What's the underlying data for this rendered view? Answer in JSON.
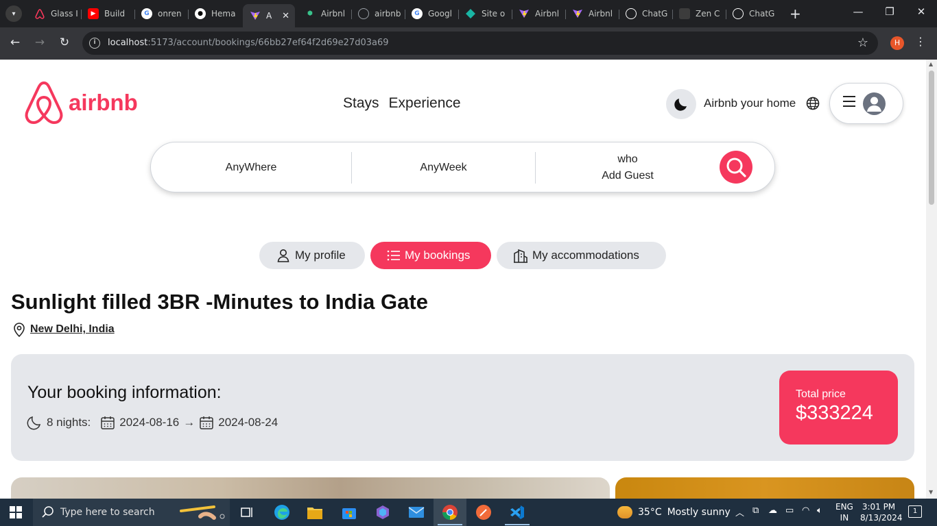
{
  "browser": {
    "tabs": [
      {
        "label": "Glass I",
        "icon": "airbnb-icon",
        "color": "#ff385c"
      },
      {
        "label": "Build",
        "icon": "youtube-icon",
        "color": "#ff0000"
      },
      {
        "label": "onren",
        "icon": "google-icon",
        "color": "#ffffff"
      },
      {
        "label": "Hema",
        "icon": "github-icon",
        "color": "#ffffff"
      },
      {
        "label": "A",
        "icon": "vite-icon",
        "color": "#a86bff",
        "active": true
      },
      {
        "label": "Airbnl",
        "icon": "shoe-icon",
        "color": "#39c28b"
      },
      {
        "label": "airbnb",
        "icon": "globe-icon",
        "color": "#9aa0a6"
      },
      {
        "label": "Googl",
        "icon": "google-icon",
        "color": "#ffffff"
      },
      {
        "label": "Site o",
        "icon": "netlify-icon",
        "color": "#19b5a4"
      },
      {
        "label": "Airbnl",
        "icon": "vite-icon",
        "color": "#a86bff"
      },
      {
        "label": "Airbnl",
        "icon": "vite-icon",
        "color": "#a86bff"
      },
      {
        "label": "ChatG",
        "icon": "chatgpt-icon",
        "color": "#ffffff"
      },
      {
        "label": "Zen C",
        "icon": "zen-icon",
        "color": "#3c3c3c"
      },
      {
        "label": "ChatG",
        "icon": "chatgpt-icon",
        "color": "#ffffff"
      }
    ],
    "url_host": "localhost",
    "url_path": ":5173/account/bookings/66bb27ef64f2d69e27d03a69",
    "profile_initial": "H"
  },
  "header": {
    "logo_text": "airbnb",
    "nav": [
      "Stays",
      "Experience"
    ],
    "host_link": "Airbnb your home"
  },
  "search": {
    "where": "AnyWhere",
    "week": "AnyWeek",
    "who_label": "who",
    "who_value": "Add Guest"
  },
  "account_nav": {
    "profile": "My profile",
    "bookings": "My bookings",
    "accommodations": "My accommodations",
    "active": "bookings"
  },
  "place": {
    "title": "Sunlight filled 3BR -Minutes to India Gate",
    "address": "New Delhi, India"
  },
  "booking": {
    "heading": "Your booking information:",
    "nights": "8 nights:",
    "check_in": "2024-08-16",
    "arrow": "→",
    "check_out": "2024-08-24",
    "price_label": "Total price",
    "price_value": "$333224"
  },
  "colors": {
    "brand": "#f5385d",
    "pill_bg": "#e5e7eb"
  },
  "taskbar": {
    "search_placeholder": "Type here to search",
    "weather_temp": "35°C",
    "weather_text": "Mostly sunny",
    "lang_line1": "ENG",
    "lang_line2": "IN",
    "time": "3:01 PM",
    "date": "8/13/2024",
    "notification_count": "1"
  }
}
